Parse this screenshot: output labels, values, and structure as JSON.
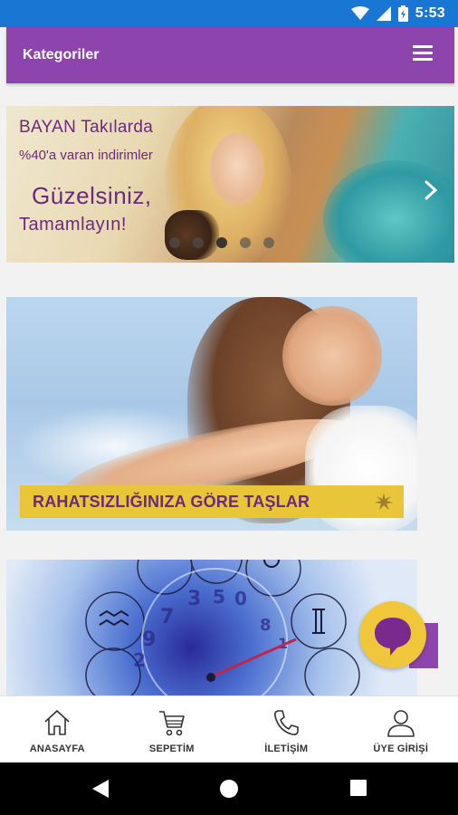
{
  "status_bar": {
    "time": "5:53"
  },
  "app_bar": {
    "title": "Kategoriler"
  },
  "slider": {
    "title": "BAYAN Takılarda",
    "subtitle": "%40'a varan indirimler",
    "headline_line1": "Güzelsiniz,",
    "headline_line2": "Tamamlayın!",
    "dot_count": 5,
    "active_dot": 2
  },
  "banner": {
    "label": "RAHATSIZLIĞINIZA GÖRE TAŞLAR"
  },
  "bottom_nav": {
    "items": [
      {
        "label": "ANASAYFA",
        "icon": "home-icon"
      },
      {
        "label": "SEPETİM",
        "icon": "cart-icon"
      },
      {
        "label": "İLETİŞİM",
        "icon": "phone-icon"
      },
      {
        "label": "ÜYE GİRİŞİ",
        "icon": "user-icon"
      }
    ]
  },
  "colors": {
    "status_bar": "#1976d2",
    "app_bar": "#8e44ad",
    "accent_yellow": "#f0c63a",
    "brand_purple": "#6b2a7d"
  }
}
